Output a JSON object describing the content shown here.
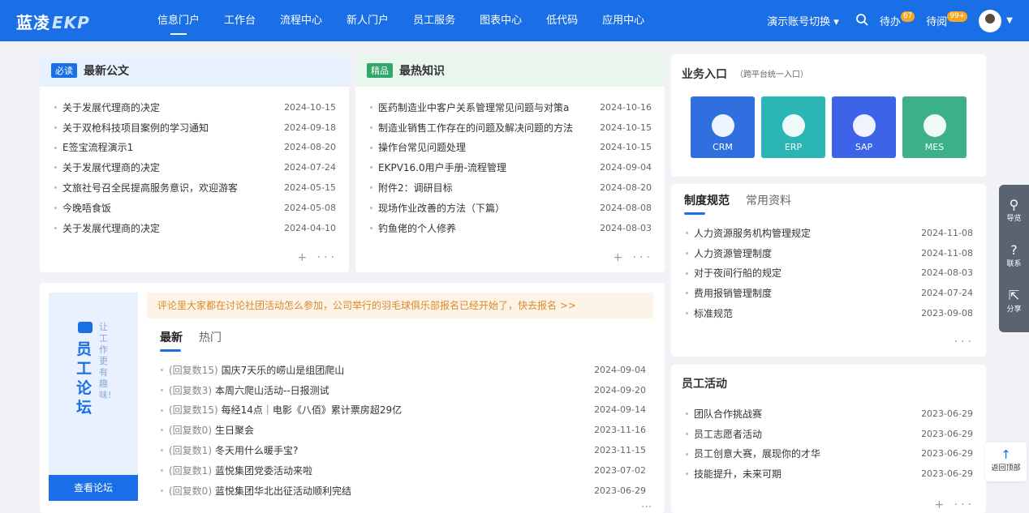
{
  "topbar": {
    "logo": "蓝凌",
    "logo_ekp": "EKP",
    "nav": [
      "信息门户",
      "工作台",
      "流程中心",
      "新人门户",
      "员工服务",
      "图表中心",
      "低代码",
      "应用中心"
    ],
    "account_switch": "演示账号切换",
    "todo": "待办",
    "todo_count": "67",
    "toread": "待阅",
    "toread_count": "99+"
  },
  "notice": {
    "tag": "必读",
    "title": "最新公文",
    "items": [
      {
        "t": "关于发展代理商的决定",
        "d": "2024-10-15"
      },
      {
        "t": "关于双枪科技项目案例的学习通知",
        "d": "2024-09-18"
      },
      {
        "t": "E签宝流程演示1",
        "d": "2024-08-20"
      },
      {
        "t": "关于发展代理商的决定",
        "d": "2024-07-24"
      },
      {
        "t": "文旅社号召全民提高服务意识，欢迎游客",
        "d": "2024-05-15"
      },
      {
        "t": "今晚唔食饭",
        "d": "2024-05-08"
      },
      {
        "t": "关于发展代理商的决定",
        "d": "2024-04-10"
      }
    ]
  },
  "knowledge": {
    "tag": "精品",
    "title": "最热知识",
    "items": [
      {
        "t": "医药制造业中客户关系管理常见问题与对策a",
        "d": "2024-10-16"
      },
      {
        "t": "制造业销售工作存在的问题及解决问题的方法",
        "d": "2024-10-15"
      },
      {
        "t": "操作台常见问题处理",
        "d": "2024-10-15"
      },
      {
        "t": "EKPV16.0用户手册-流程管理",
        "d": "2024-09-04"
      },
      {
        "t": "附件2：调研目标",
        "d": "2024-08-20"
      },
      {
        "t": "现场作业改善的方法（下篇）",
        "d": "2024-08-08"
      },
      {
        "t": "钓鱼佬的个人修养",
        "d": "2024-08-03"
      }
    ]
  },
  "business": {
    "title": "业务入口",
    "subtitle": "（跨平台统一入口）",
    "items": [
      {
        "label": "CRM",
        "color": "#2f6fe0",
        "icon": "building-icon"
      },
      {
        "label": "ERP",
        "color": "#2bb5b5",
        "icon": "ship-icon"
      },
      {
        "label": "SAP",
        "color": "#3d63e8",
        "icon": "sap-icon"
      },
      {
        "label": "MES",
        "color": "#3cb08a",
        "icon": "gear-icon"
      }
    ]
  },
  "policy": {
    "tabs": [
      "制度规范",
      "常用资料"
    ],
    "items": [
      {
        "t": "人力资源服务机构管理规定",
        "d": "2024-11-08"
      },
      {
        "t": "人力资源管理制度",
        "d": "2024-11-08"
      },
      {
        "t": "对于夜间行船的规定",
        "d": "2024-08-03"
      },
      {
        "t": "费用报销管理制度",
        "d": "2024-07-24"
      },
      {
        "t": "标准规范",
        "d": "2023-09-08"
      }
    ]
  },
  "forum": {
    "title": "员工论坛",
    "slogan": "让工作更有趣味!",
    "view_btn": "查看论坛",
    "banner": "评论里大家都在讨论社团活动怎么参加，公司举行的羽毛球俱乐部报名已经开始了，快去报名 >>",
    "tabs": [
      "最新",
      "热门"
    ],
    "items": [
      {
        "r": "(回复数15)",
        "t": "国庆7天乐的崂山是组团爬山",
        "d": "2024-09-04"
      },
      {
        "r": "(回复数3)",
        "t": "本周六爬山活动--日报测试",
        "d": "2024-09-20"
      },
      {
        "r": "(回复数15)",
        "t": "每经14点｜电影《八佰》累计票房超29亿",
        "d": "2024-09-14"
      },
      {
        "r": "(回复数0)",
        "t": "生日聚会",
        "d": "2023-11-16"
      },
      {
        "r": "(回复数1)",
        "t": "冬天用什么暖手宝?",
        "d": "2023-11-15"
      },
      {
        "r": "(回复数1)",
        "t": "蓝悦集团党委活动来啦",
        "d": "2023-07-02"
      },
      {
        "r": "(回复数0)",
        "t": "蓝悦集团华北出征活动顺利完结",
        "d": "2023-06-29"
      }
    ]
  },
  "activity": {
    "title": "员工活动",
    "items": [
      {
        "t": "团队合作挑战赛",
        "d": "2023-06-29"
      },
      {
        "t": "员工志愿者活动",
        "d": "2023-06-29"
      },
      {
        "t": "员工创意大赛，展现你的才华",
        "d": "2023-06-29"
      },
      {
        "t": "技能提升，未来可期",
        "d": "2023-06-29"
      }
    ]
  },
  "side": {
    "items": [
      "导览",
      "联系",
      "分享"
    ],
    "back_top": "返回顶部"
  }
}
